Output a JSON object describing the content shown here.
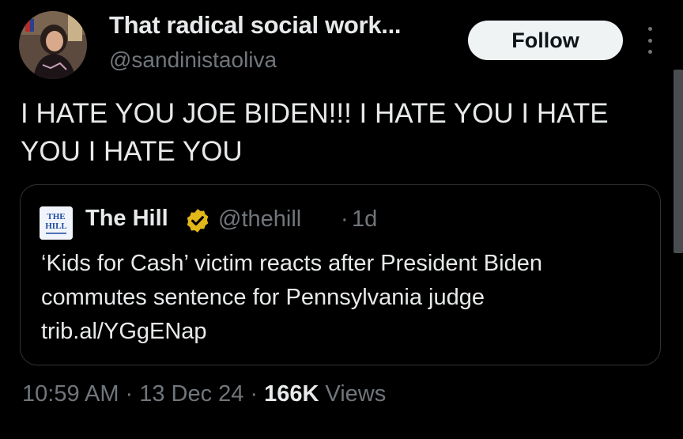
{
  "author": {
    "display_name": "That radical social work...",
    "handle": "@sandinistaoliva",
    "avatar_icon": "profile-photo"
  },
  "actions": {
    "follow_label": "Follow",
    "more_icon": "more-vertical-icon"
  },
  "tweet": {
    "text": "I HATE YOU JOE BIDEN!!! I HATE YOU I HATE YOU I HATE YOU"
  },
  "quote": {
    "name": "The Hill",
    "handle": "@thehill",
    "separator": "·",
    "time": "1d",
    "text": "‘Kids for Cash’ victim reacts after President Biden commutes sentence for Pennsylvania judge trib.al/YGgENap",
    "logo_text_top": "THE",
    "logo_text_bottom": "HILL",
    "verified_color": "#e2b719"
  },
  "meta": {
    "time": "10:59 AM",
    "separator1": "·",
    "date": "13 Dec 24",
    "separator2": "·",
    "views_count": "166K",
    "views_label": "Views"
  },
  "colors": {
    "background": "#000000",
    "text_primary": "#e7e9ea",
    "text_secondary": "#71767b",
    "border": "#2f3336",
    "follow_bg": "#eff3f4"
  }
}
